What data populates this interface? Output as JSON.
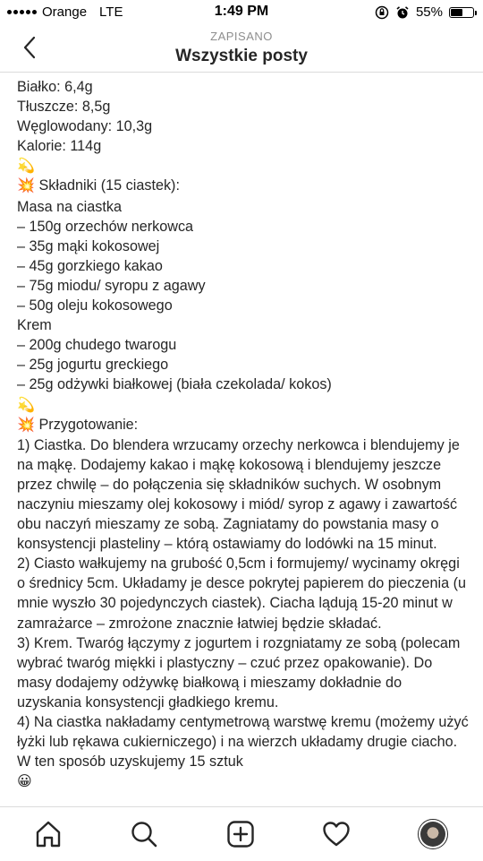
{
  "status_bar": {
    "carrier": "Orange",
    "network": "LTE",
    "time": "1:49 PM",
    "battery_percent": "55%",
    "battery_level": 0.55
  },
  "header": {
    "subtitle": "ZAPISANO",
    "title": "Wszystkie posty"
  },
  "post": {
    "lines": [
      "Białko: 6,4g",
      "Tłuszcze: 8,5g",
      "Węglowodany: 10,3g",
      "Kalorie: 114g"
    ],
    "ingredients_heading": "Składniki (15 ciastek):",
    "ingredients": [
      "Masa na ciastka",
      "– 150g orzechów nerkowca",
      "– 35g mąki kokosowej",
      "– 45g gorzkiego kakao",
      "– 75g miodu/ syropu z agawy",
      "– 50g oleju kokosowego",
      "Krem",
      "– 200g chudego twarogu",
      "– 25g jogurtu greckiego",
      "– 25g odżywki białkowej (biała czekolada/ kokos)"
    ],
    "preparation_heading": "Przygotowanie:",
    "steps": [
      "1) Ciastka. Do blendera wrzucamy orzechy nerkowca i blendujemy je na mąkę. Dodajemy kakao i mąkę kokosową i blendujemy jeszcze przez chwilę – do połączenia się składników suchych. W osobnym naczyniu mieszamy olej kokosowy i miód/ syrop z agawy i zawartość obu naczyń mieszamy ze sobą. Zagniatamy do powstania masy o konsystencji plasteliny – którą ostawiamy do lodówki na 15 minut.",
      "2) Ciasto wałkujemy na grubość 0,5cm i formujemy/ wycinamy okręgi o średnicy 5cm. Układamy je desce pokrytej papierem do pieczenia (u mnie wyszło 30 pojedynczych ciastek). Ciacha lądują 15-20 minut w zamrażarce – zmrożone znacznie łatwiej będzie składać.",
      "3) Krem. Twaróg łączymy z jogurtem i rozgniatamy ze sobą (polecam wybrać twaróg miękki i plastyczny – czuć przez opakowanie). Do masy dodajemy odżywkę białkową i mieszamy dokładnie do uzyskania konsystencji gładkiego kremu.",
      "4) Na ciastka nakładamy centymetrową warstwę kremu (możemy użyć łyżki lub rękawa cukierniczego) i na wierzch układamy drugie ciacho. W ten sposób uzyskujemy 15 sztuk"
    ],
    "emoji_dizzy": "💫",
    "emoji_collision": "💥",
    "emoji_grin": "😀"
  },
  "nav": {
    "icons": [
      "home-icon",
      "search-icon",
      "add-post-icon",
      "activity-heart-icon",
      "profile-avatar"
    ]
  }
}
